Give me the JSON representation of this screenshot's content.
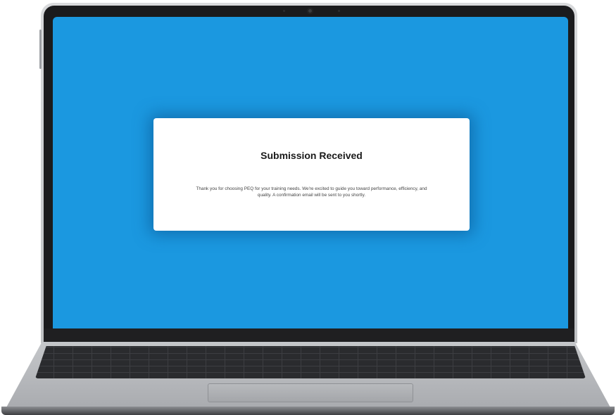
{
  "modal": {
    "title": "Submission Received",
    "message": "Thank you for choosing PEQ for your training needs. We're excited to guide you toward performance, efficiency, and quality. A confirmation email will be sent to you shortly."
  },
  "colors": {
    "screen_background": "#1b98e0",
    "modal_background": "#ffffff",
    "title_text": "#1a1a1a",
    "body_text": "#444444"
  },
  "icons": {
    "camera": "webcam-icon"
  }
}
